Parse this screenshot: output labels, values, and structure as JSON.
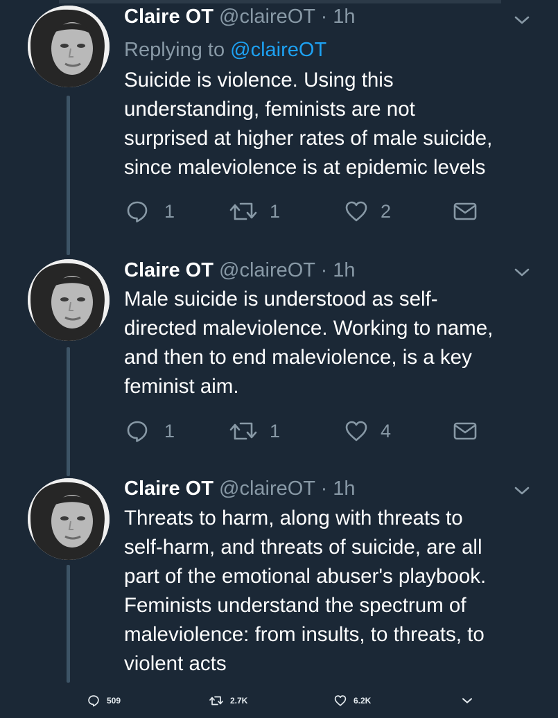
{
  "tweets": [
    {
      "name": "Claire OT",
      "handle": "@claireOT",
      "separator": "·",
      "time": "1h",
      "replying_prefix": "Replying to",
      "replying_to": "@claireOT",
      "lines": [
        "Suicide is violence. Using this",
        "understanding, feminists are not",
        "surprised at higher rates of male suicide,",
        "since maleviolence is at epidemic levels"
      ],
      "replies": "1",
      "retweets": "1",
      "likes": "2"
    },
    {
      "name": "Claire OT",
      "handle": "@claireOT",
      "separator": "·",
      "time": "1h",
      "lines": [
        "Male suicide is understood as self-",
        "directed maleviolence. Working to name,",
        "and then to end maleviolence, is a key",
        "feminist aim."
      ],
      "replies": "1",
      "retweets": "1",
      "likes": "4"
    },
    {
      "name": "Claire OT",
      "handle": "@claireOT",
      "separator": "·",
      "time": "1h",
      "lines": [
        "Threats to harm, along with threats to",
        "self-harm, and threats of suicide, are all",
        "part of the emotional abuser's playbook.",
        "Feminists understand the spectrum of",
        "maleviolence: from insults, to threats, to",
        "violent acts"
      ]
    }
  ],
  "footer": {
    "replies": "509",
    "retweets": "2.7K",
    "likes": "6.2K"
  },
  "colors": {
    "background": "#1b2836",
    "secondary_text": "#8899a6",
    "mention": "#1da1f2",
    "thread_line": "#3d5466"
  },
  "icons": [
    "reply-icon",
    "retweet-icon",
    "like-icon",
    "message-icon",
    "chevron-down-icon"
  ]
}
